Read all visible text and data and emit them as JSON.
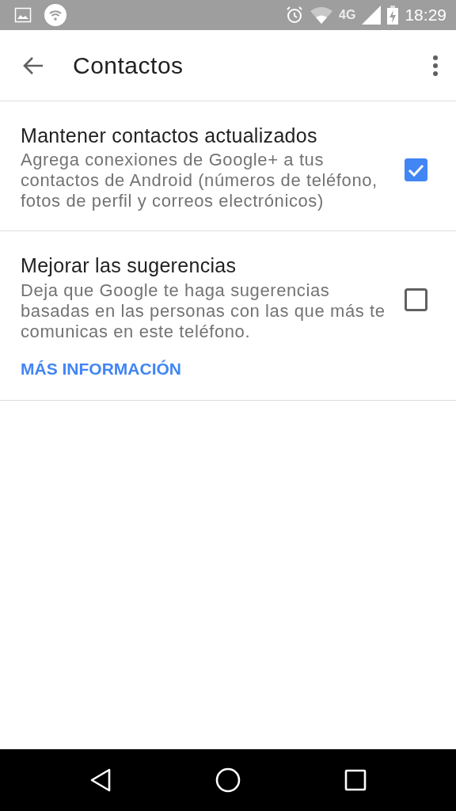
{
  "status_bar": {
    "network": "4G",
    "time": "18:29"
  },
  "app_bar": {
    "title": "Contactos"
  },
  "settings": [
    {
      "title": "Mantener contactos actualizados",
      "summary": "Agrega conexiones de Google+ a tus contactos de Android (números de teléfono, fotos de perfil y correos electrónicos)",
      "checked": true
    },
    {
      "title": "Mejorar las sugerencias",
      "summary": "Deja que Google te haga sugerencias basadas en las personas con las que más te comunicas en este teléfono.",
      "checked": false,
      "link": "MÁS INFORMACIÓN"
    }
  ]
}
